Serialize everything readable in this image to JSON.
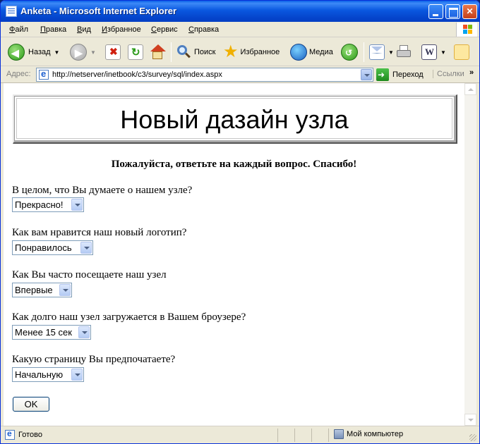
{
  "window": {
    "title": "Anketa - Microsoft Internet Explorer"
  },
  "menu": [
    "Файл",
    "Правка",
    "Вид",
    "Избранное",
    "Сервис",
    "Справка"
  ],
  "toolbar": {
    "back_label": "Назад",
    "search_label": "Поиск",
    "favorites_label": "Избранное",
    "media_label": "Медиа"
  },
  "address": {
    "label": "Адрес:",
    "url": "http://netserver/inetbook/c3/survey/sql/index.aspx",
    "go_label": "Переход",
    "links_label": "Ссылки"
  },
  "page": {
    "banner_title": "Новый дазайн узла",
    "intro": "Пожалуйста, ответьте на каждый вопрос. Спасибо!",
    "questions": [
      {
        "text": "В целом, что Вы думаете о нашем узле?",
        "selected": "Прекрасно!"
      },
      {
        "text": "Как вам нравится наш новый логотип?",
        "selected": "Понравилось"
      },
      {
        "text": "Как Вы часто посещаете наш узел",
        "selected": "Впервые"
      },
      {
        "text": "Как долго наш узел загружается в Вашем броузере?",
        "selected": "Менее 15 сек"
      },
      {
        "text": "Какую страницу Вы предпочатаете?",
        "selected": "Начальную"
      }
    ],
    "ok_label": "OK"
  },
  "status": {
    "text": "Готово",
    "zone": "Мой компьютер"
  },
  "colors": {
    "titlebar": "#0a58e0",
    "chrome": "#ece9d8",
    "content_bg": "#ffffff"
  },
  "icons": [
    "ie-page-icon",
    "minimize-icon",
    "maximize-icon",
    "close-icon",
    "windows-logo-icon",
    "back-arrow-icon",
    "forward-arrow-icon",
    "stop-icon",
    "refresh-icon",
    "home-icon",
    "search-icon",
    "favorites-star-icon",
    "media-icon",
    "history-icon",
    "mail-icon",
    "print-icon",
    "word-icon",
    "messenger-icon",
    "go-arrow-icon",
    "computer-icon"
  ]
}
